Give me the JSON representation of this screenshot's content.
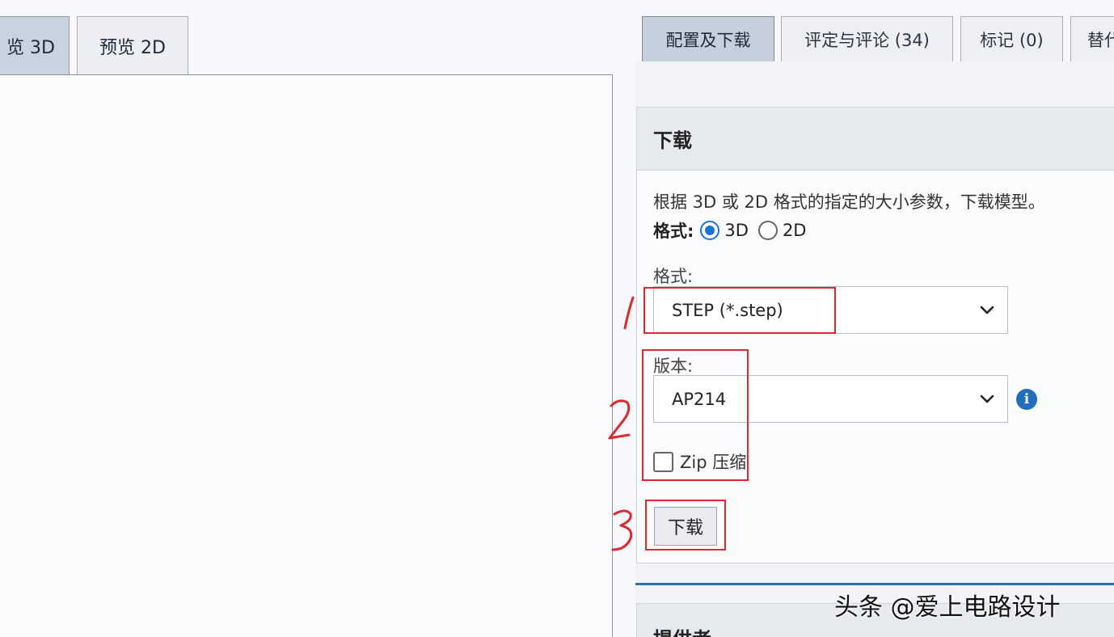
{
  "left_tabs": {
    "active": "览 3D",
    "inactive": "预览 2D"
  },
  "right_tabs": [
    "配置及下载",
    "评定与评论 (34)",
    "标记 (0)",
    "替代"
  ],
  "download_panel": {
    "title": "下载",
    "description": "根据 3D 或 2D 格式的指定的大小参数，下载模型。",
    "format_label": "格式:",
    "radio_3d": "3D",
    "radio_2d": "2D",
    "radio_selected": "3D",
    "format_field_label": "格式:",
    "format_value": "STEP (*.step)",
    "version_label": "版本:",
    "version_value": "AP214",
    "zip_label": "Zip 压缩",
    "zip_checked": false,
    "download_button": "下载"
  },
  "provider_panel": {
    "title": "提供者"
  },
  "annotations": [
    "1",
    "2",
    "3"
  ],
  "watermark": "头条 @爱上电路设计",
  "colors": {
    "accent_blue": "#1a73d9",
    "annotation_red": "#e0262f",
    "info_blue": "#1e6fc0",
    "divider_blue": "#2f6fa8"
  }
}
